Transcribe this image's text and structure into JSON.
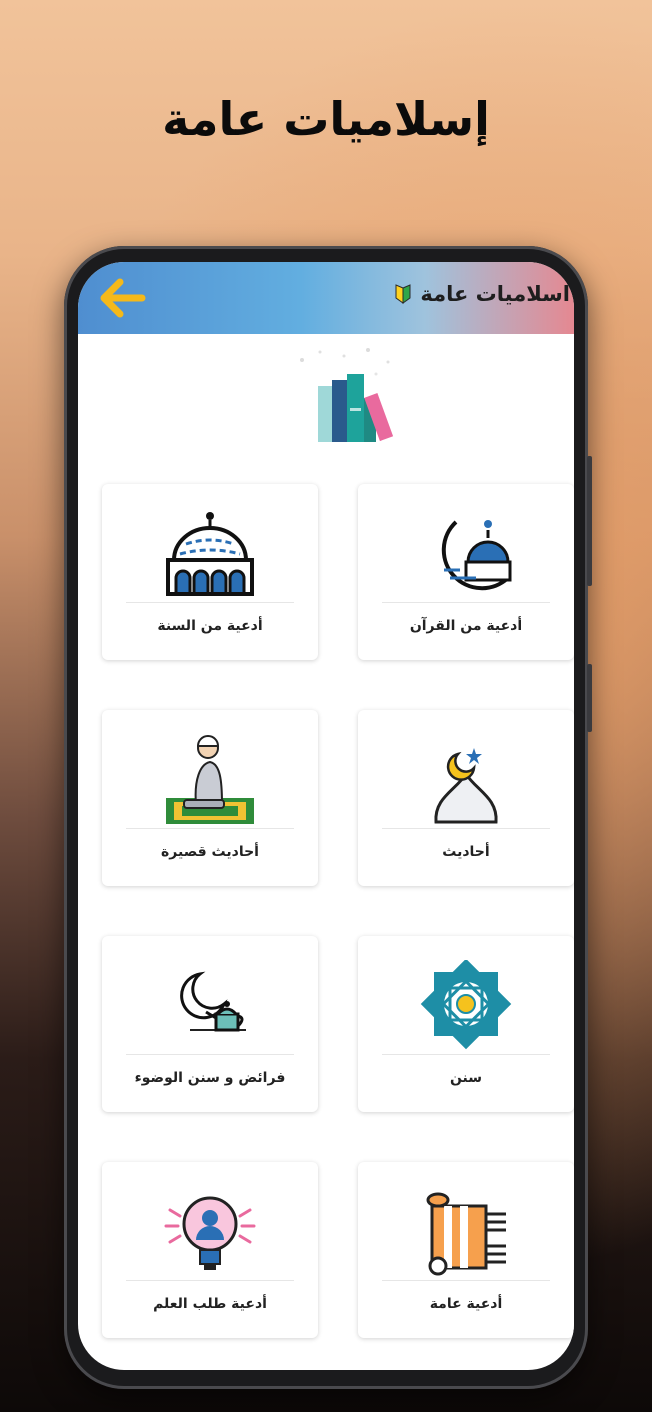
{
  "promo": {
    "title": "إسلاميات عامة"
  },
  "app_bar": {
    "title": "اسلاميات عامة"
  },
  "cards": [
    {
      "label": "أدعية من القرآن",
      "icon": "crescent-mosque-icon"
    },
    {
      "label": "أدعية من السنة",
      "icon": "mosque-dome-icon"
    },
    {
      "label": "أحاديث",
      "icon": "dome-crescent-icon"
    },
    {
      "label": "أحاديث قصيرة",
      "icon": "praying-man-icon"
    },
    {
      "label": "سنن",
      "icon": "islamic-star-icon"
    },
    {
      "label": "فرائض و سنن الوضوء",
      "icon": "moon-teapot-icon"
    },
    {
      "label": "أدعية عامة",
      "icon": "prayer-rug-icon"
    },
    {
      "label": "أدعية طلب العلم",
      "icon": "lightbulb-person-icon"
    }
  ],
  "colors": {
    "accent_blue": "#2a6fb5",
    "accent_teal": "#1ea39b",
    "accent_pink": "#e96a9e",
    "back_arrow": "#f5b91a"
  }
}
